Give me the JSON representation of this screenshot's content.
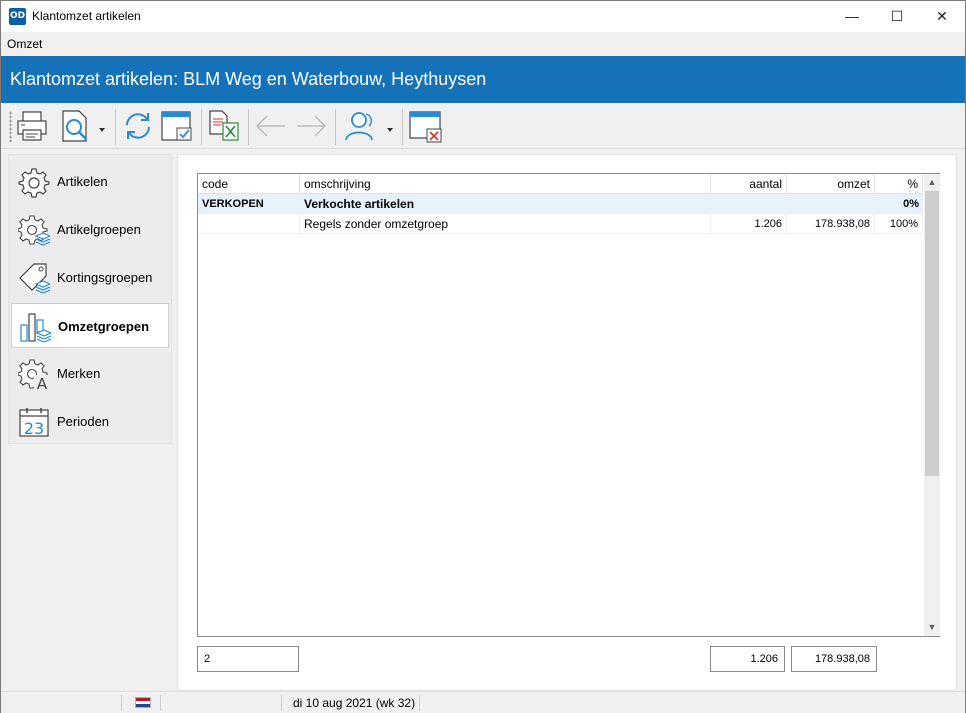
{
  "window": {
    "app_icon_text": "OD",
    "title": "Klantomzet artikelen",
    "min_glyph": "—",
    "max_glyph": "☐",
    "close_glyph": "✕"
  },
  "menu": {
    "items": [
      "Omzet"
    ]
  },
  "header": {
    "title": "Klantomzet artikelen: BLM Weg en Waterbouw, Heythuysen"
  },
  "toolbar": {
    "buttons": [
      "printer-icon",
      "print-preview-icon",
      "refresh-icon",
      "select-window-icon",
      "export-excel-icon",
      "back-arrow-icon",
      "forward-arrow-icon",
      "customer-icon",
      "close-window-icon"
    ]
  },
  "nav": {
    "items": [
      {
        "label": "Artikelen",
        "icon": "gear-icon"
      },
      {
        "label": "Artikelgroepen",
        "icon": "gear-stack-icon"
      },
      {
        "label": "Kortingsgroepen",
        "icon": "tag-stack-icon"
      },
      {
        "label": "Omzetgroepen",
        "icon": "bar-chart-icon"
      },
      {
        "label": "Merken",
        "icon": "gear-letter-icon"
      },
      {
        "label": "Perioden",
        "icon": "calendar-icon"
      }
    ],
    "active": "Omzetgroepen",
    "calendar_day": "23",
    "merken_letter": "A"
  },
  "grid": {
    "columns": {
      "code": "code",
      "omschrijving": "omschrijving",
      "aantal": "aantal",
      "omzet": "omzet",
      "pct": "%"
    },
    "group_row": {
      "code": "VERKOPEN",
      "omschrijving": "Verkochte artikelen",
      "aantal": "",
      "omzet": "",
      "pct": "0%"
    },
    "rows": [
      {
        "code": "",
        "omschrijving": "Regels zonder omzetgroep",
        "aantal": "1.206",
        "omzet": "178.938,08",
        "pct": "100%"
      }
    ],
    "scroll_up": "▲",
    "scroll_down": "▼"
  },
  "totals": {
    "count": "2",
    "aantal": "1.206",
    "omzet": "178.938,08"
  },
  "status": {
    "date": "di 10 aug 2021 (wk 32)"
  },
  "colors": {
    "accent": "#1572b8",
    "selection": "#e6f1fb",
    "icon_blue": "#2a8ad4"
  }
}
